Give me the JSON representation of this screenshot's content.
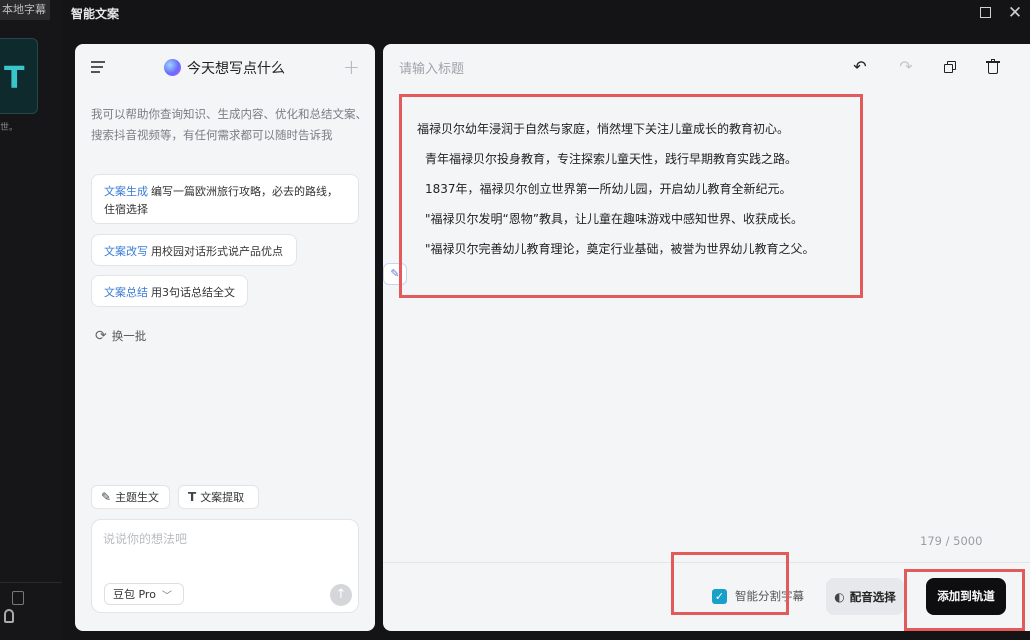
{
  "background": {
    "tab_label": "本地字幕",
    "thumb_letter": "T",
    "thumb_caption": "世。"
  },
  "window": {
    "title": "智能文案",
    "maximize_label": "",
    "close_label": "✕"
  },
  "assistant": {
    "heading": "今天想写点什么",
    "add_label": "+",
    "intro": "我可以帮助你查询知识、生成内容、优化和总结文案、搜索抖音视频等，有任何需求都可以随时告诉我",
    "suggestions": [
      {
        "tag": "文案生成",
        "text": "编写一篇欧洲旅行攻略，必去的路线，住宿选择"
      },
      {
        "tag": "文案改写",
        "text": "用校园对话形式说产品优点"
      },
      {
        "tag": "文案总结",
        "text": "用3句话总结全文"
      }
    ],
    "refresh_label": "换一批",
    "chips": [
      {
        "icon": "✎",
        "label": "主题生文"
      },
      {
        "icon": "T",
        "label": "文案提取"
      }
    ],
    "input_placeholder": "说说你的想法吧",
    "model_label": "豆包 Pro",
    "model_chevron": "﹀",
    "send_icon": "↑"
  },
  "editor": {
    "title_placeholder": "请输入标题",
    "toolbar": {
      "undo": "↶",
      "redo": "↷"
    },
    "paragraphs": [
      "福禄贝尔幼年浸润于自然与家庭，悄然埋下关注儿童成长的教育初心。",
      "青年福禄贝尔投身教育，专注探索儿童天性，践行早期教育实践之路。",
      "1837年，福禄贝尔创立世界第一所幼儿园，开启幼儿教育全新纪元。",
      "\"福禄贝尔发明“恩物”教具，让儿童在趣味游戏中感知世界、收获成长。",
      "\"福禄贝尔完善幼儿教育理论，奠定行业基础，被誉为世界幼儿教育之父。"
    ],
    "side_tool_icon": "✎",
    "char_count": "179 / 5000",
    "smart_split_label": "智能分割字幕",
    "smart_split_checked": true,
    "voice_label": "配音选择",
    "add_track_label": "添加到轨道",
    "highlight_color": "#e35a5a"
  }
}
